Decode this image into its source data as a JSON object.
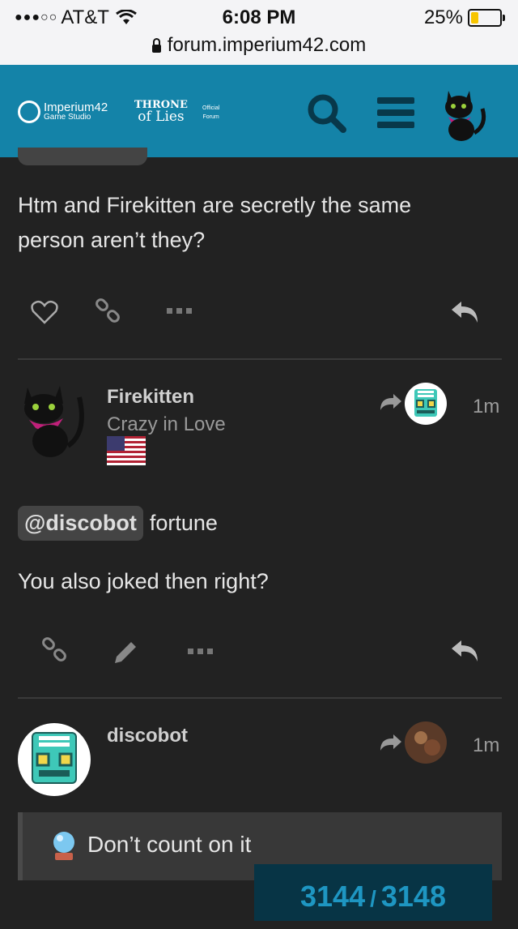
{
  "status_bar": {
    "signal": "●●●○○",
    "carrier": "AT&T",
    "time": "6:08 PM",
    "battery": "25%",
    "battery_level": 0.25,
    "url": "forum.imperium42.com"
  },
  "header": {
    "logo_primary": "Imperium42",
    "logo_secondary": "Game Studio",
    "logo_game_line1": "Throne",
    "logo_game_line2": "of Lies",
    "logo_official_line1": "Official",
    "logo_official_line2": "Forum"
  },
  "posts": [
    {
      "text": "Htm and Firekitten are secretly the same person aren’t they?"
    },
    {
      "username": "Firekitten",
      "user_title": "Crazy in Love",
      "time": "1m",
      "mention": "@discobot",
      "mention_rest": "fortune",
      "text": "You also joked then right?"
    },
    {
      "username": "discobot",
      "time": "1m",
      "quote": "Don’t count on it"
    }
  ],
  "progress": {
    "current": "3144",
    "separator": "/",
    "total": "3148"
  },
  "colors": {
    "header_bg": "#1483a8",
    "page_bg": "#222222",
    "progress_bg": "#073445",
    "progress_text": "#1e96c2"
  }
}
